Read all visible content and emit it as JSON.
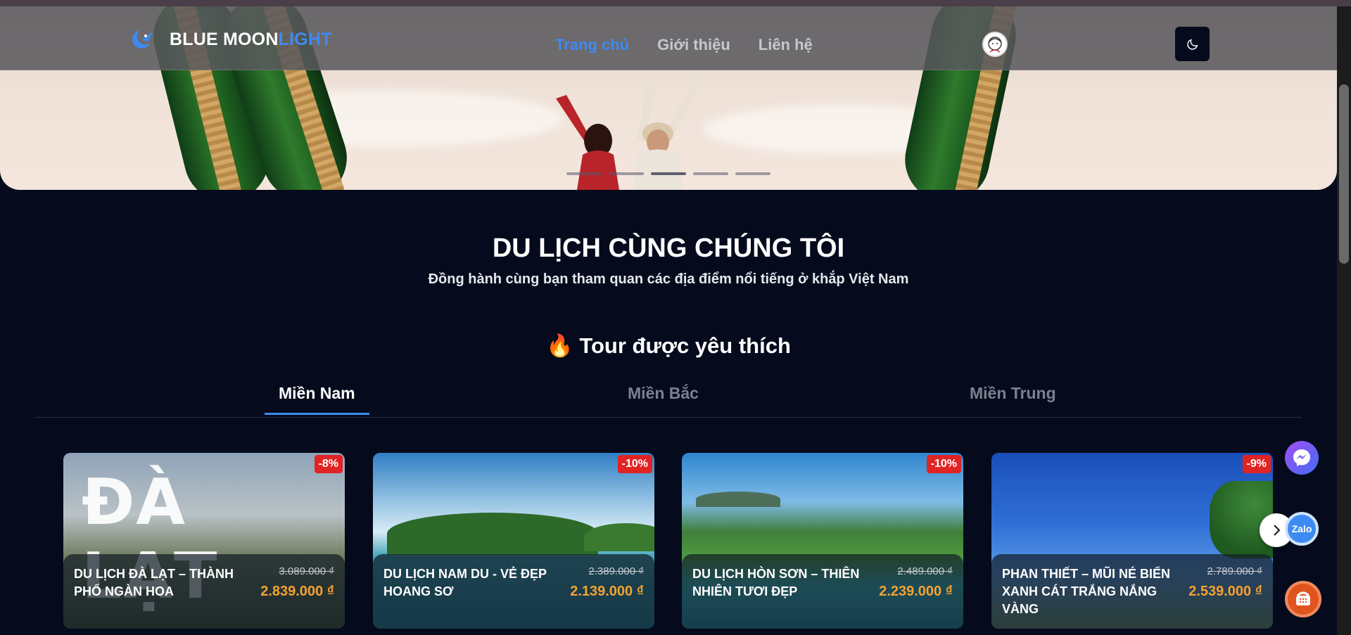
{
  "brand": {
    "name_part1": "BLUE MOON",
    "name_part2": "LIGHT"
  },
  "nav": {
    "items": [
      "Trang chủ",
      "Giới thiệu",
      "Liên hệ"
    ],
    "active": 0
  },
  "hero": {
    "slides": 5,
    "active_slide": 2
  },
  "headline": {
    "title": "DU LỊCH CÙNG CHÚNG TÔI",
    "subtitle": "Đồng hành cùng bạn tham quan các địa điểm nổi tiếng ở khắp Việt Nam"
  },
  "favorites": {
    "heading_icon": "🔥",
    "heading": "Tour được yêu thích",
    "tabs": [
      "Miền Nam",
      "Miền Bắc",
      "Miền Trung"
    ],
    "active_tab": 0
  },
  "tours": [
    {
      "name": "DU LỊCH ĐÀ LẠT – THÀNH PHỐ NGÀN HOA",
      "badge": "-8%",
      "old_price": "3.089.000 ₫",
      "new_price": "2.839.000 ₫",
      "image_text": "ĐÀ LẠT"
    },
    {
      "name": "DU LỊCH NAM DU - VẺ ĐẸP HOANG SƠ",
      "badge": "-10%",
      "old_price": "2.389.000 ₫",
      "new_price": "2.139.000 ₫"
    },
    {
      "name": "DU LỊCH HÒN SƠN – THIÊN NHIÊN TƯƠI ĐẸP",
      "badge": "-10%",
      "old_price": "2.489.000 ₫",
      "new_price": "2.239.000 ₫"
    },
    {
      "name": "PHAN THIẾT – MŨI NÉ BIỂN XANH CÁT TRẮNG NẮNG VÀNG",
      "badge": "-9%",
      "old_price": "2.789.000 ₫",
      "new_price": "2.539.000 ₫"
    }
  ],
  "floating": {
    "zalo_label": "Zalo"
  },
  "colors": {
    "accent": "#3d8bf2",
    "price": "#f4a233",
    "badge": "#e02424",
    "background": "#050b1c"
  }
}
